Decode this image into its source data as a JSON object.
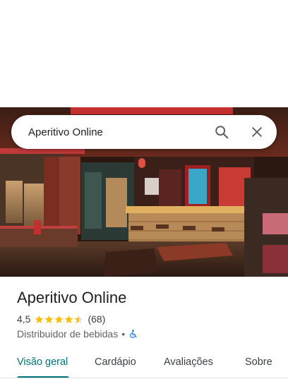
{
  "search": {
    "query": "Aperitivo Online"
  },
  "place": {
    "name": "Aperitivo Online",
    "rating": "4,5",
    "rating_value": 4.5,
    "review_count": "(68)",
    "category": "Distribuidor de bebidas",
    "separator": "•"
  },
  "tabs": [
    {
      "label": "Visão geral",
      "active": true
    },
    {
      "label": "Cardápio",
      "active": false
    },
    {
      "label": "Avaliações",
      "active": false
    },
    {
      "label": "Sobre",
      "active": false
    }
  ],
  "icons": {
    "search": "search-icon",
    "close": "close-icon",
    "accessibility": "wheelchair-icon",
    "star": "star-icon"
  },
  "colors": {
    "accent": "#00747d",
    "star": "#fbbc04",
    "accessibility": "#1a73e8"
  }
}
